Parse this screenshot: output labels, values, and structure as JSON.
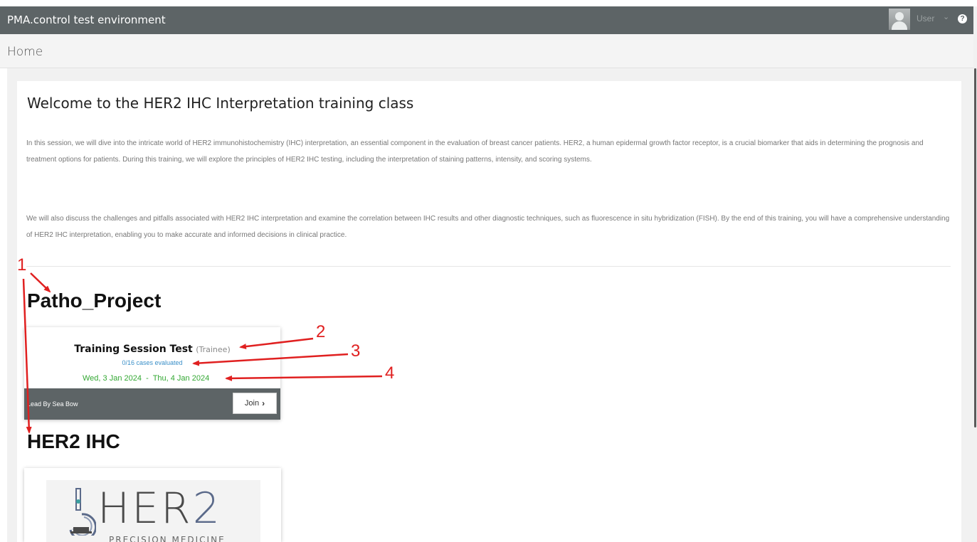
{
  "header": {
    "app_title": "PMA.control test environment",
    "user_label": "User",
    "user_chevron": "⌄",
    "help_glyph": "?"
  },
  "breadcrumb": {
    "current": "Home"
  },
  "welcome": {
    "title": "Welcome to the HER2 IHC Interpretation training class",
    "paragraph_1": "In this session, we will dive into the intricate world of HER2 immunohistochemistry (IHC) interpretation, an essential component in the evaluation of breast cancer patients. HER2, a human epidermal growth factor receptor, is a crucial biomarker that aids in determining the prognosis and treatment options for patients. During this training, we will explore the principles of HER2 IHC testing, including the interpretation of staining patterns, intensity, and scoring systems.",
    "paragraph_2": "We will also discuss the challenges and pitfalls associated with HER2 IHC interpretation and examine the correlation between IHC results and other diagnostic techniques, such as fluorescence in situ hybridization (FISH). By the end of this training, you will have a comprehensive understanding of HER2 IHC interpretation, enabling you to make accurate and informed decisions in clinical practice."
  },
  "projects": [
    {
      "name": "Patho_Project",
      "sessions": [
        {
          "title": "Training Session Test",
          "role": "(Trainee)",
          "progress_text": "0/16 cases evaluated",
          "start_date": "Wed, 3 Jan 2024",
          "date_separator": "-",
          "end_date": "Thu, 4 Jan 2024",
          "lead": "Lead By Sea Bow",
          "join_label": "Join",
          "join_chevron": "›"
        }
      ]
    },
    {
      "name": "HER2 IHC",
      "logo": {
        "main_text": "HER",
        "digit": "2",
        "subtitle": "PRECISION MEDICINE"
      }
    }
  ],
  "annotations": {
    "color": "#e02020",
    "labels": [
      "1",
      "2",
      "3",
      "4"
    ]
  }
}
